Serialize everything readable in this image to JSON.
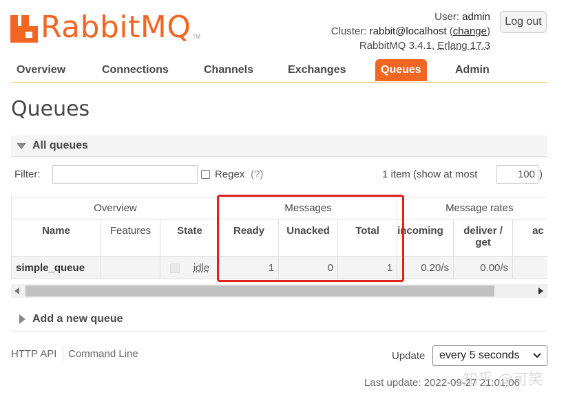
{
  "logo": {
    "text": "RabbitMQ",
    "tm": "TM"
  },
  "header": {
    "user_label": "User:",
    "user": "admin",
    "cluster_label": "Cluster:",
    "cluster": "rabbit@localhost",
    "change_open": "(",
    "change": "change",
    "change_close": ")",
    "version": "RabbitMQ 3.4.1,",
    "erlang": "Erlang 17.3",
    "logout": "Log out"
  },
  "tabs": [
    "Overview",
    "Connections",
    "Channels",
    "Exchanges",
    "Queues",
    "Admin"
  ],
  "page_title": "Queues",
  "section": {
    "all_queues": "All queues",
    "filter_label": "Filter:",
    "filter_value": "",
    "regex_label": "Regex",
    "regex_help": "(?)",
    "item_count": "1 item (show at most",
    "max_value": "100",
    "max_close": ")"
  },
  "table": {
    "groups": [
      "Overview",
      "Messages",
      "Message rates"
    ],
    "columns": [
      "Name",
      "Features",
      "State",
      "Ready",
      "Unacked",
      "Total",
      "incoming",
      "deliver / get",
      "ac"
    ],
    "rows": [
      {
        "name": "simple_queue",
        "features": "",
        "state": "idle",
        "ready": "1",
        "unacked": "0",
        "total": "1",
        "incoming": "0.20/s",
        "deliver_get": "0.00/s",
        "ack": ""
      }
    ]
  },
  "add_queue": "Add a new queue",
  "footer": {
    "http_api": "HTTP API",
    "command_line": "Command Line",
    "update_label": "Update",
    "update_value": "every 5 seconds",
    "last_update": "Last update: 2022-09-27 21:01:06"
  },
  "watermark": "知乎 @可笑",
  "colors": {
    "brand": "#f26522",
    "tab_border": "#f2b44a",
    "highlight": "#e0221b"
  }
}
